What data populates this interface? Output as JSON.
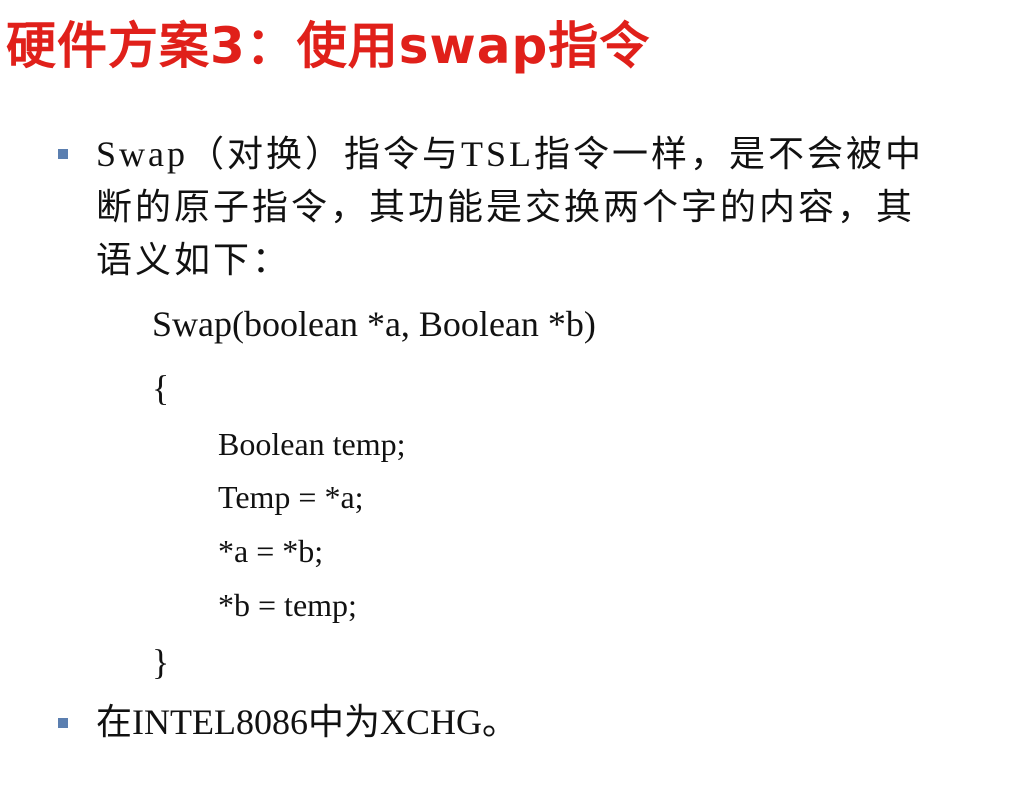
{
  "title": "硬件方案3：使用swap指令",
  "bullet1": {
    "lines": [
      "Swap（对换）指令与TSL指令一样，是不会被中",
      "断的原子指令，其功能是交换两个字的内容，其",
      "语义如下："
    ]
  },
  "code": {
    "signature": "Swap(boolean *a, Boolean *b)",
    "open_brace": "{",
    "body": [
      "Boolean temp;",
      "Temp = *a;",
      "*a = *b;",
      "*b = temp;"
    ],
    "close_brace": "}"
  },
  "bullet2": {
    "text": "在INTEL8086中为XCHG。"
  },
  "colors": {
    "title": "#e0201a",
    "bullet_marker": "#5b7fb0",
    "text": "#111111"
  }
}
